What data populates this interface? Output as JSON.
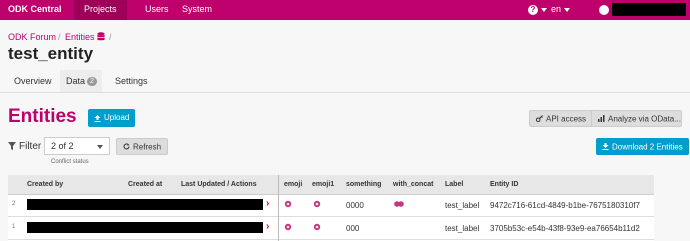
{
  "nav": {
    "brand": "ODK Central",
    "items": [
      "Projects",
      "Users",
      "System"
    ],
    "help": "?",
    "lang": "en"
  },
  "breadcrumb": [
    "ODK Forum",
    "Entities"
  ],
  "page_title": "test_entity",
  "tabs": [
    {
      "label": "Overview"
    },
    {
      "label": "Data",
      "badge": "2"
    },
    {
      "label": "Settings"
    }
  ],
  "main": {
    "title": "Entities",
    "upload_label": "Upload",
    "api_access_label": "API access",
    "odata_label": "Analyze via OData...",
    "filter_label": "Filter",
    "filter_value": "2 of 2",
    "filter_caption": "Conflict status",
    "refresh_label": "Refresh",
    "download_label": "Download 2 Entities"
  },
  "table": {
    "headers": [
      "Created by",
      "Created at",
      "Last Updated / Actions",
      "emoji",
      "emoji1",
      "something",
      "with_concat",
      "Label",
      "Entity ID"
    ],
    "rows": [
      {
        "num": "2",
        "something": "0000",
        "label": "test_label",
        "entity_id": "9472c716-61cd-4849-b1be-7675180310f7"
      },
      {
        "num": "1",
        "something": "000",
        "label": "test_label",
        "entity_id": "3705b53c-e54b-43f8-93e9-ea76654b11d2"
      }
    ]
  },
  "colors": {
    "brand": "#bd006b",
    "primary": "#009ecc"
  }
}
